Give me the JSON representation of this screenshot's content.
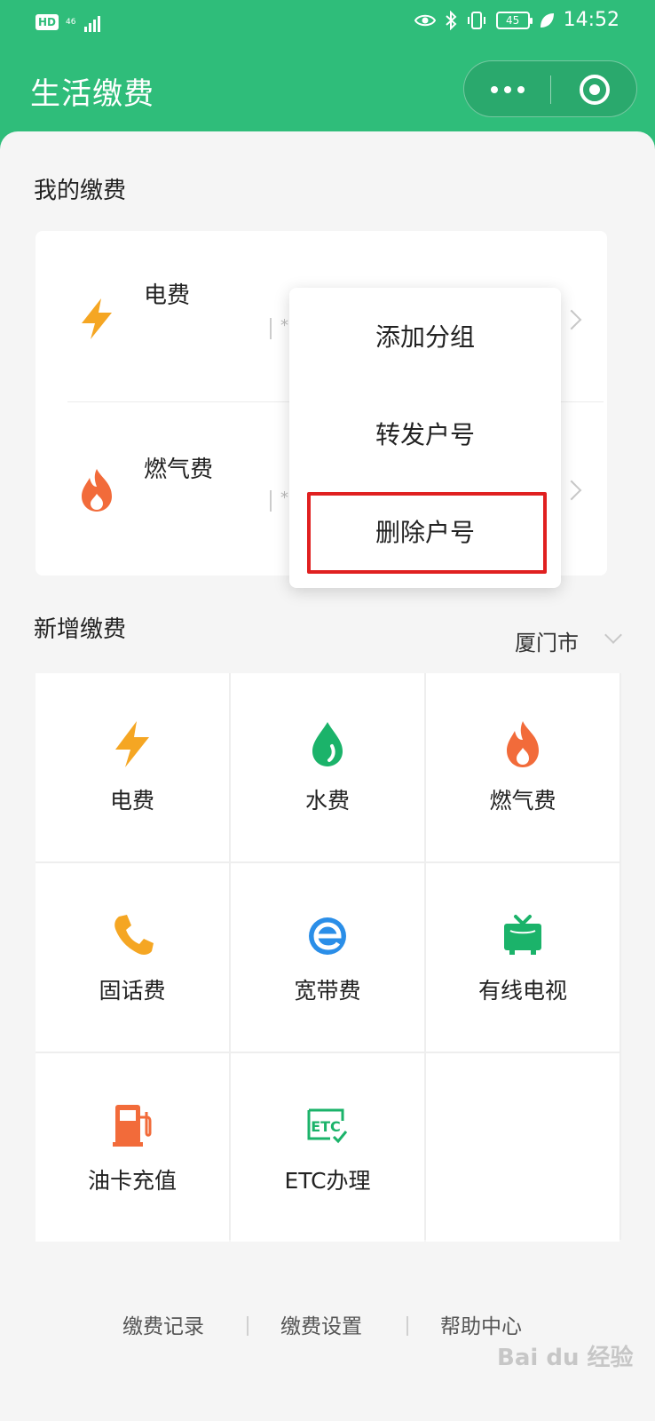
{
  "status_bar": {
    "hd": "HD",
    "network": "46",
    "battery": "45",
    "time": "14:52"
  },
  "nav": {
    "title": "生活缴费"
  },
  "my_bills": {
    "title": "我的缴费",
    "items": [
      {
        "name": "电费",
        "account": "*",
        "icon": "lightning-icon"
      },
      {
        "name": "燃气费",
        "account": "*",
        "icon": "flame-icon"
      }
    ]
  },
  "context_menu": {
    "items": [
      "添加分组",
      "转发户号",
      "删除户号"
    ],
    "highlighted": "删除户号"
  },
  "new_bills": {
    "title": "新增缴费",
    "city": "厦门市",
    "items": [
      {
        "label": "电费",
        "icon": "lightning-icon"
      },
      {
        "label": "水费",
        "icon": "water-drop-icon"
      },
      {
        "label": "燃气费",
        "icon": "flame-icon"
      },
      {
        "label": "固话费",
        "icon": "phone-icon"
      },
      {
        "label": "宽带费",
        "icon": "broadband-e-icon"
      },
      {
        "label": "有线电视",
        "icon": "tv-icon"
      },
      {
        "label": "油卡充值",
        "icon": "fuel-pump-icon"
      },
      {
        "label": "ETC办理",
        "icon": "etc-icon"
      }
    ]
  },
  "footer": {
    "links": [
      "缴费记录",
      "缴费设置",
      "帮助中心"
    ]
  },
  "colors": {
    "primary": "#2fbd7a",
    "lightning": "#f5a623",
    "flame": "#f26b3a",
    "water": "#1bb36a",
    "highlight": "#e02020"
  },
  "watermark": "Bai du 经验"
}
